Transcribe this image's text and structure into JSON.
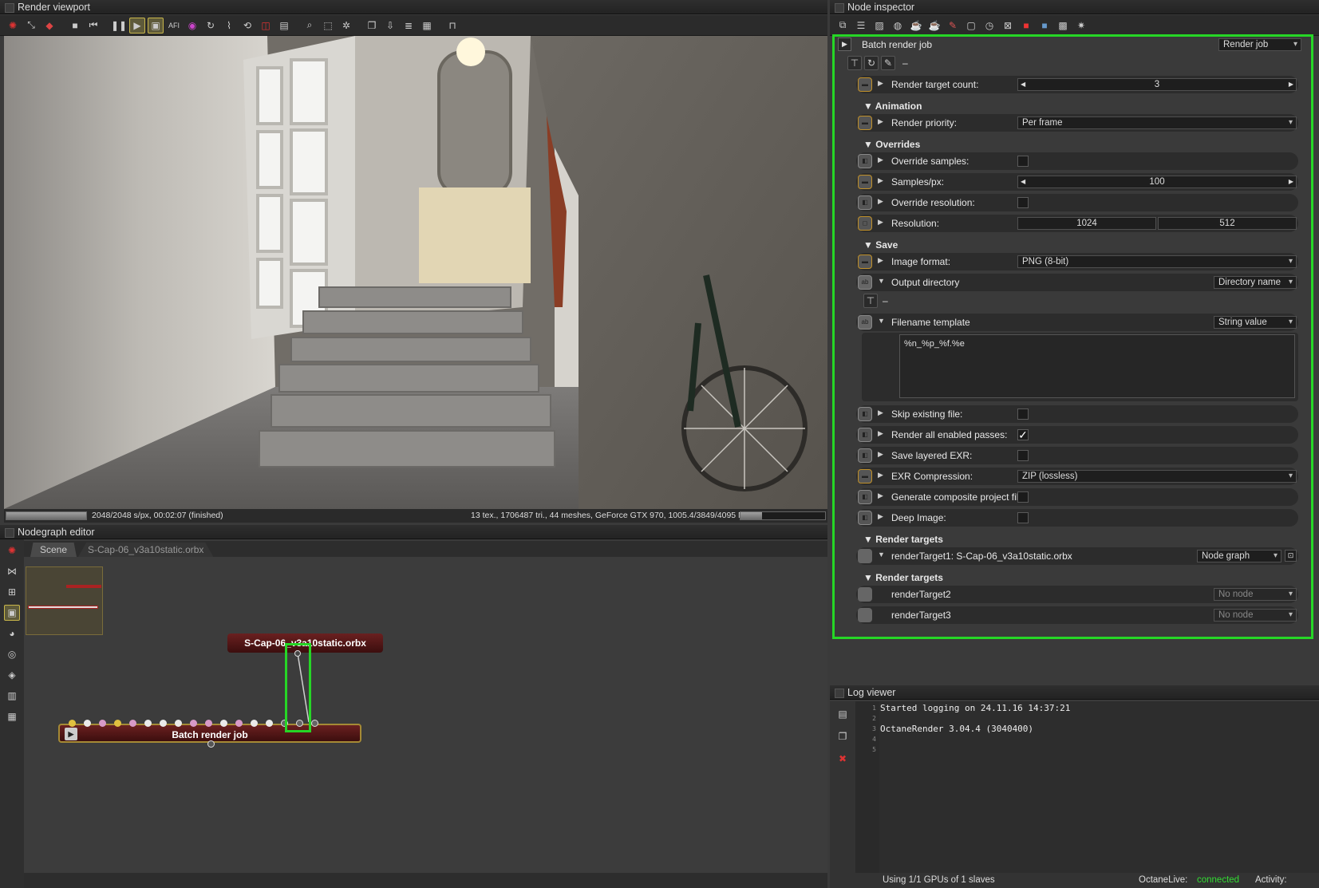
{
  "viewport": {
    "title": "Render viewport",
    "status_left": "2048/2048 s/px, 00:02:07 (finished)",
    "status_right": "13 tex., 1706487 tri., 44 meshes, GeForce GTX 970, 1005.4/3849/4095 MB",
    "afi_label": "AFI"
  },
  "nodegraph": {
    "title": "Nodegraph editor",
    "tabs": [
      "Scene",
      "S-Cap-06_v3a10static.orbx"
    ],
    "mesh_node": "S-Cap-06_v3a10static.orbx",
    "batch_node": "Batch render job"
  },
  "inspector": {
    "title": "Node inspector",
    "root_label": "Batch render job",
    "root_type": "Render job",
    "root_dash": "–",
    "render_target_count_label": "Render target count:",
    "render_target_count": "3",
    "sec_animation": "Animation",
    "render_priority_label": "Render priority:",
    "render_priority": "Per frame",
    "sec_overrides": "Overrides",
    "override_samples_label": "Override samples:",
    "samples_label": "Samples/px:",
    "samples": "100",
    "override_resolution_label": "Override resolution:",
    "resolution_label": "Resolution:",
    "res_w": "1024",
    "res_h": "512",
    "sec_save": "Save",
    "image_format_label": "Image format:",
    "image_format": "PNG (8-bit)",
    "output_dir_label": "Output directory",
    "output_dir_type": "Directory name",
    "output_dash": "–",
    "filename_label": "Filename template",
    "filename_type": "String value",
    "filename_value": "%n_%p_%f.%e",
    "skip_existing_label": "Skip existing file:",
    "render_all_passes_label": "Render all enabled passes:",
    "render_all_passes_check": "✓",
    "save_layered_label": "Save layered EXR:",
    "exr_compression_label": "EXR Compression:",
    "exr_compression": "ZIP (lossless)",
    "composite_label": "Generate composite project file:",
    "deep_image_label": "Deep Image:",
    "sec_render_targets_1": "Render targets",
    "rt1_label": "renderTarget1: S-Cap-06_v3a10static.orbx",
    "rt1_type": "Node graph",
    "sec_render_targets_2": "Render targets",
    "rt2_label": "renderTarget2",
    "rt2_type": "No node",
    "rt3_label": "renderTarget3",
    "rt3_type": "No node"
  },
  "log": {
    "title": "Log viewer",
    "line_numbers": [
      "1",
      "2",
      "3",
      "4",
      "5"
    ],
    "lines": [
      "Started logging on 24.11.16 14:37:21",
      "",
      "OctaneRender 3.04.4 (3040400)",
      "",
      ""
    ],
    "gpu_status": "Using 1/1 GPUs of 1 slaves",
    "live_label": "OctaneLive:",
    "live_status": "connected",
    "activity_label": "Activity:"
  },
  "colors": {
    "highlight": "#26d626",
    "connected": "#33dd33",
    "node_red": "#5a1818"
  }
}
